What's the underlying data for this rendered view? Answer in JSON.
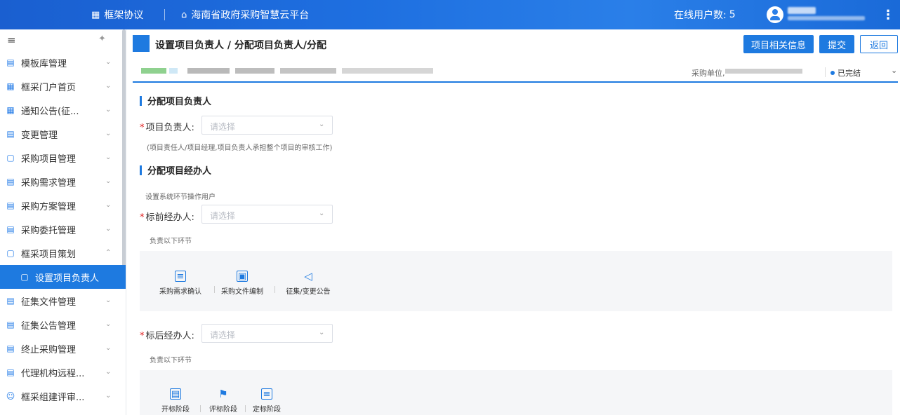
{
  "header": {
    "brand": "框架协议",
    "platform": "海南省政府采购智慧云平台",
    "online_label": "在线用户数:",
    "online_count": "5"
  },
  "sidebar": {
    "items": [
      {
        "label": "模板库管理",
        "icon": "template-icon"
      },
      {
        "label": "框采门户首页",
        "icon": "grid-icon"
      },
      {
        "label": "通知公告(征...",
        "icon": "grid-icon"
      },
      {
        "label": "变更管理",
        "icon": "change-icon"
      },
      {
        "label": "采购项目管理",
        "icon": "folder-icon"
      },
      {
        "label": "采购需求管理",
        "icon": "doc-icon"
      },
      {
        "label": "采购方案管理",
        "icon": "doc-icon"
      },
      {
        "label": "采购委托管理",
        "icon": "doc-icon"
      },
      {
        "label": "框采项目策划",
        "icon": "folder-icon",
        "expanded": true
      },
      {
        "label": "设置项目负责人",
        "icon": "folder-user-icon",
        "active": true
      },
      {
        "label": "征集文件管理",
        "icon": "doc-icon"
      },
      {
        "label": "征集公告管理",
        "icon": "doc-icon"
      },
      {
        "label": "终止采购管理",
        "icon": "stop-icon"
      },
      {
        "label": "代理机构远程...",
        "icon": "doc-icon"
      },
      {
        "label": "框采组建评审...",
        "icon": "people-icon"
      }
    ]
  },
  "page": {
    "title": "设置项目负责人 / 分配项目负责人/分配",
    "btn_info": "项目相关信息",
    "btn_submit": "提交",
    "btn_back": "返回",
    "unit_label": "采购单位,",
    "status": "已完结"
  },
  "section1": {
    "title": "分配项目负责人",
    "field_label": "项目负责人:",
    "placeholder": "请选择",
    "hint": "(项目责任人/项目经理,项目负责人承担整个项目的审核工作)"
  },
  "section2": {
    "title": "分配项目经办人",
    "subtitle": "设置系统环节操作用户",
    "pre_label": "标前经办人:",
    "pre_placeholder": "请选择",
    "pre_hint": "负责以下环节",
    "pre_stages": [
      "采购需求确认",
      "采购文件编制",
      "征集/变更公告"
    ],
    "post_label": "标后经办人:",
    "post_placeholder": "请选择",
    "post_hint": "负责以下环节",
    "post_stages": [
      "开标阶段",
      "评标阶段",
      "定标阶段"
    ]
  },
  "colors": {
    "primary": "#1e7ae0",
    "header": "#1e6fe0",
    "required": "#e02020"
  }
}
